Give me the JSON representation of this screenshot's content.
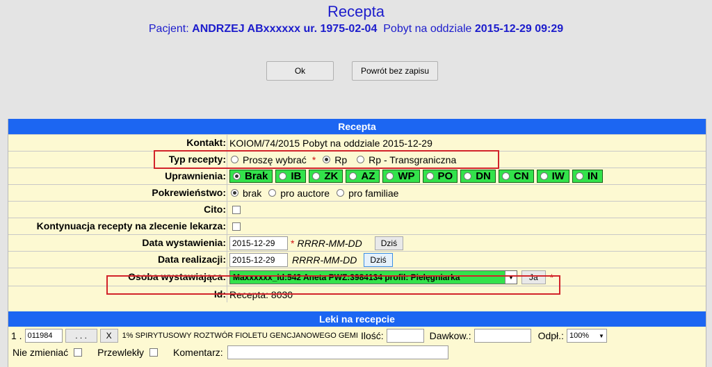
{
  "header": {
    "title": "Recepta",
    "patient_label": "Pacjent:",
    "patient_name": "ANDRZEJ ABxxxxxx ur. 1975-02-04",
    "stay_label": "Pobyt na oddziale",
    "stay_date": "2015-12-29 09:29"
  },
  "buttons": {
    "ok": "Ok",
    "back": "Powrót bez zapisu"
  },
  "section_recepta": "Recepta",
  "rows": {
    "kontakt": {
      "label": "Kontakt:",
      "value": "KOIOM/74/2015 Pobyt na oddziale 2015-12-29"
    },
    "typ": {
      "label": "Typ recepty:",
      "opt1": "Proszę wybrać",
      "opt2": "Rp",
      "opt3": "Rp - Transgraniczna"
    },
    "uprawnienia": {
      "label": "Uprawnienia:",
      "options": [
        "Brak",
        "IB",
        "ZK",
        "AZ",
        "WP",
        "PO",
        "DN",
        "CN",
        "IW",
        "IN"
      ]
    },
    "pokrew": {
      "label": "Pokrewieństwo:",
      "opt1": "brak",
      "opt2": "pro auctore",
      "opt3": "pro familiae"
    },
    "cito": {
      "label": "Cito:"
    },
    "kontynuacja": {
      "label": "Kontynuacja recepty na zlecenie lekarza:"
    },
    "data_wyst": {
      "label": "Data wystawienia:",
      "value": "2015-12-29",
      "format": "RRRR-MM-DD",
      "btn": "Dziś"
    },
    "data_real": {
      "label": "Data realizacji:",
      "value": "2015-12-29",
      "format": "RRRR-MM-DD",
      "btn": "Dziś"
    },
    "osoba": {
      "label": "Osoba wystawiająca:",
      "value": "Maxxxxxx_id:542 Aneta PWZ:3984134 profil: Pielęgniarka",
      "btn": "Ja"
    },
    "id": {
      "label": "Id:",
      "value": "Recepta: 8030"
    }
  },
  "section_leki": "Leki na recepcie",
  "drug": {
    "index": "1 .",
    "code": "011984",
    "dots": ". . .",
    "x": "X",
    "name": "1% SPIRYTUSOWY ROZTWÓR FIOLETU GENCJANOWEGO GEMI",
    "ilosc": "Ilość:",
    "dawkow": "Dawkow.:",
    "odpl": "Odpł.:",
    "odpl_value": "100%",
    "nie_zmieniac": "Nie zmieniać",
    "przewlekly": "Przewlekły",
    "komentarz": "Komentarz:"
  },
  "colors": {
    "title_blue": "#1c1ccc",
    "bar_blue": "#1c66f2",
    "panel_bg": "#fdf9d2",
    "green": "#33e24b",
    "highlight_red": "#d2232a"
  }
}
